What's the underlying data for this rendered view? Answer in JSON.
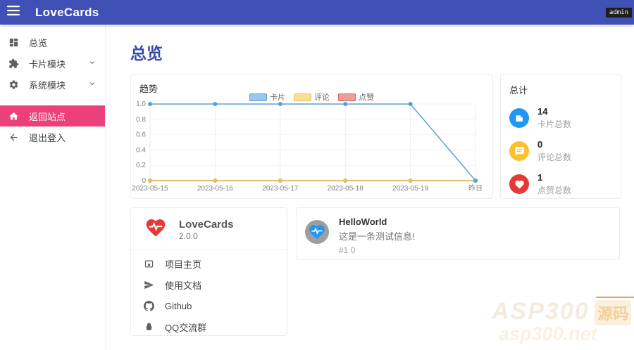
{
  "navbar": {
    "title": "LoveCards",
    "user_badge": "admin"
  },
  "sidebar": {
    "items": [
      {
        "label": "总览"
      },
      {
        "label": "卡片模块"
      },
      {
        "label": "系统模块"
      },
      {
        "label": "返回站点"
      },
      {
        "label": "退出登入"
      }
    ]
  },
  "page": {
    "title": "总览"
  },
  "trend_card": {
    "title": "趋势"
  },
  "chart_data": {
    "type": "line",
    "title": "趋势",
    "x": [
      "2023-05-15",
      "2023-05-16",
      "2023-05-17",
      "2023-05-18",
      "2023-05-19",
      "昨日"
    ],
    "y_ticks": [
      0,
      0.2,
      0.4,
      0.6,
      0.8,
      1.0
    ],
    "ylim": [
      0,
      1.0
    ],
    "grid": true,
    "legend_position": "top-center",
    "series": [
      {
        "name": "卡片",
        "color": "#5b9fd8",
        "swatch_fill": "#9ac6ec",
        "values": [
          1,
          1,
          1,
          1,
          1,
          0
        ]
      },
      {
        "name": "评论",
        "color": "#e2c15c",
        "swatch_fill": "#f3e292",
        "values": [
          0,
          0,
          0,
          0,
          0,
          0
        ]
      },
      {
        "name": "点赞",
        "color": "#d4695f",
        "swatch_fill": "#ea9f97",
        "values": [
          0,
          0,
          0,
          0,
          0,
          0
        ]
      }
    ]
  },
  "totals_card": {
    "title": "总计",
    "stats": [
      {
        "value": "14",
        "label": "卡片总数",
        "color": "#2196f3",
        "icon": "note-icon"
      },
      {
        "value": "0",
        "label": "评论总数",
        "color": "#fbc02d",
        "icon": "comment-icon"
      },
      {
        "value": "1",
        "label": "点赞总数",
        "color": "#e53935",
        "icon": "heart-icon"
      }
    ]
  },
  "about_card": {
    "app_name": "LoveCards",
    "version": "2.0.0",
    "links": [
      {
        "label": "项目主页",
        "icon": "homepage-icon"
      },
      {
        "label": "使用文档",
        "icon": "send-icon"
      },
      {
        "label": "Github",
        "icon": "github-icon"
      },
      {
        "label": "QQ交流群",
        "icon": "qq-icon"
      }
    ]
  },
  "message_card": {
    "author": "HelloWorld",
    "content": "这是一条测试信息!",
    "meta": "#1 0"
  },
  "watermark": {
    "text": "ASP300",
    "badge": "源码",
    "subtext": "asp300.net"
  },
  "colors": {
    "navbar": "#3f51b5",
    "accent": "#3949ab",
    "active_item": "#ec407a"
  }
}
